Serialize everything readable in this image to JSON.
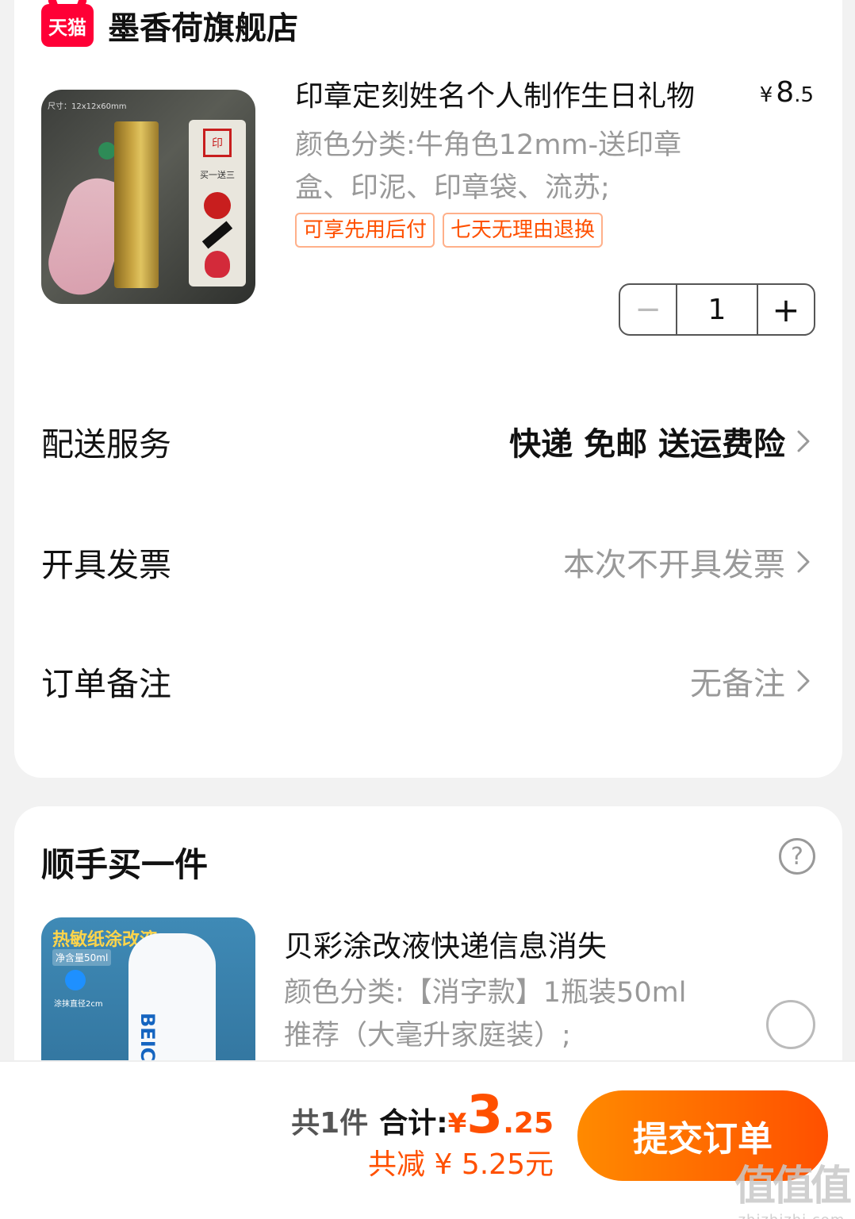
{
  "store": {
    "logo_text": "天猫",
    "name": "墨香荷旗舰店"
  },
  "product": {
    "image_size_text": "尺寸：12x12x60mm",
    "image_side_text": "买一送三",
    "title": "印章定刻姓名个人制作生日礼物",
    "price_symbol": "¥",
    "price_int": "8",
    "price_dec": ".5",
    "spec": "颜色分类:牛角色12mm-送印章盒、印泥、印章袋、流苏;",
    "tags": [
      "可享先用后付",
      "七天无理由退换"
    ],
    "quantity": "1",
    "minus": "−",
    "plus": "+"
  },
  "rows": {
    "delivery": {
      "label": "配送服务",
      "value": "快递 免邮 送运费险"
    },
    "invoice": {
      "label": "开具发票",
      "value": "本次不开具发票"
    },
    "note": {
      "label": "订单备注",
      "value": "无备注"
    }
  },
  "addon": {
    "section_title": "顺手买一件",
    "help": "?",
    "image_title": "热敏纸涂改液",
    "image_sub": "净含量50ml",
    "image_dot_text": "涂抹直径2cm",
    "image_brand": "BEICA",
    "title": "贝彩涂改液快递信息消失",
    "spec": "颜色分类:【消字款】1瓶装50ml 推荐（大毫升家庭装）;"
  },
  "summary": {
    "count": "共1件",
    "total_label": "合计:",
    "total_symbol": "¥",
    "total_int": "3",
    "total_dec": ".25",
    "discount": "共减 ¥ 5.25元",
    "submit": "提交订单"
  },
  "watermark": {
    "big": "值值值",
    "small": "zhizhizhi.com"
  },
  "colors": {
    "accent": "#ff5000",
    "tmall_red": "#ff0036",
    "muted": "#999999"
  }
}
